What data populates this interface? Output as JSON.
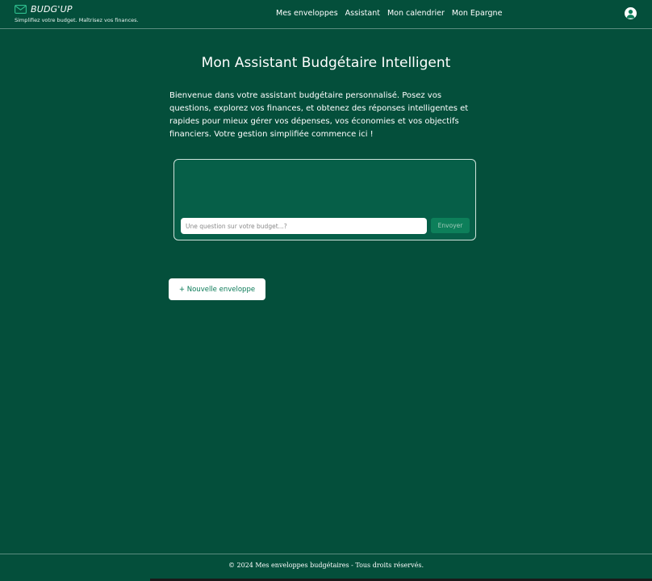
{
  "brand": {
    "name": "BUDG'UP",
    "tagline": "Simplifiez votre budget. Maîtrisez vos finances."
  },
  "nav": {
    "items": [
      "Mes enveloppes",
      "Assistant",
      "Mon calendrier",
      "Mon Epargne"
    ]
  },
  "main": {
    "title": "Mon Assistant Budgétaire Intelligent",
    "intro": "Bienvenue dans votre assistant budgétaire personnalisé. Posez vos questions, explorez vos finances, et obtenez des réponses intelligentes et rapides pour mieux gérer vos dépenses, vos économies et vos objectifs financiers. Votre gestion simplifiée commence ici !",
    "chat": {
      "input_value": "",
      "placeholder": "Une question sur votre budget...?",
      "send_label": "Envoyer"
    },
    "new_envelope_label": "+ Nouvelle enveloppe"
  },
  "footer": {
    "text": "© 2024 Mes enveloppes budgétaires - Tous droits réservés."
  },
  "icons": {
    "brand": "envelope-icon",
    "user": "user-avatar-icon"
  },
  "colors": {
    "background": "#044f3b",
    "chat_background": "#065f48",
    "send_button": "#0d7f5a",
    "accent_text": "#0a7a57"
  }
}
